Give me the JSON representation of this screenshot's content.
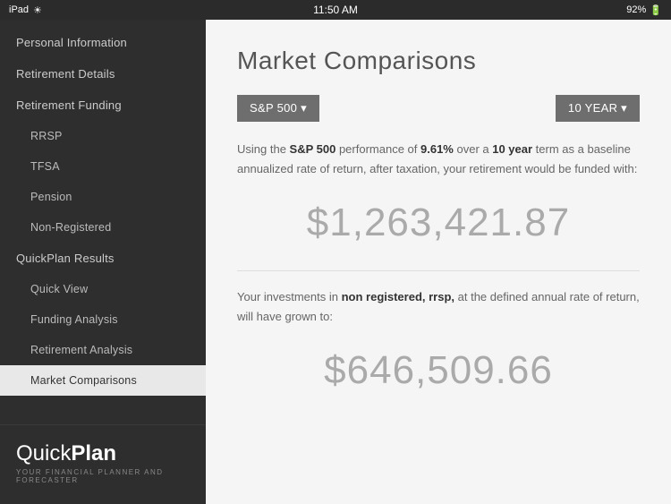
{
  "statusBar": {
    "left": "iPad",
    "time": "11:50 AM",
    "battery": "92%"
  },
  "sidebar": {
    "items": [
      {
        "id": "personal-information",
        "label": "Personal Information",
        "level": "top",
        "active": false
      },
      {
        "id": "retirement-details",
        "label": "Retirement Details",
        "level": "top",
        "active": false
      },
      {
        "id": "retirement-funding",
        "label": "Retirement Funding",
        "level": "top",
        "active": false
      },
      {
        "id": "rrsp",
        "label": "RRSP",
        "level": "sub",
        "active": false
      },
      {
        "id": "tfsa",
        "label": "TFSA",
        "level": "sub",
        "active": false
      },
      {
        "id": "pension",
        "label": "Pension",
        "level": "sub",
        "active": false
      },
      {
        "id": "non-registered",
        "label": "Non-Registered",
        "level": "sub",
        "active": false
      },
      {
        "id": "quickplan-results",
        "label": "QuickPlan Results",
        "level": "top",
        "active": false
      },
      {
        "id": "quick-view",
        "label": "Quick View",
        "level": "sub",
        "active": false
      },
      {
        "id": "funding-analysis",
        "label": "Funding Analysis",
        "level": "sub",
        "active": false
      },
      {
        "id": "retirement-analysis",
        "label": "Retirement Analysis",
        "level": "sub",
        "active": false
      },
      {
        "id": "market-comparisons",
        "label": "Market Comparisons",
        "level": "sub",
        "active": true
      }
    ],
    "brand": {
      "logo_light": "Quick",
      "logo_bold": "Plan",
      "tagline": "YOUR FINANCIAL PLANNER AND FORECASTER"
    }
  },
  "main": {
    "page_title": "Market Comparisons",
    "btn_index": "S&P 500 ▾",
    "btn_term": "10 YEAR ▾",
    "description1_prefix": "Using the ",
    "description1_index": "S&P 500",
    "description1_middle": " performance of ",
    "description1_rate": "9.61%",
    "description1_term_pre": " over a ",
    "description1_term": "10 year",
    "description1_suffix": " term as a baseline annualized rate of return, after taxation, your retirement would be funded with:",
    "amount1": "$1,263,421.87",
    "description2_prefix": "Your investments in ",
    "description2_bold": "non registered, rrsp,",
    "description2_suffix": " at the defined annual rate of return, will have grown to:",
    "amount2": "$646,509.66"
  }
}
